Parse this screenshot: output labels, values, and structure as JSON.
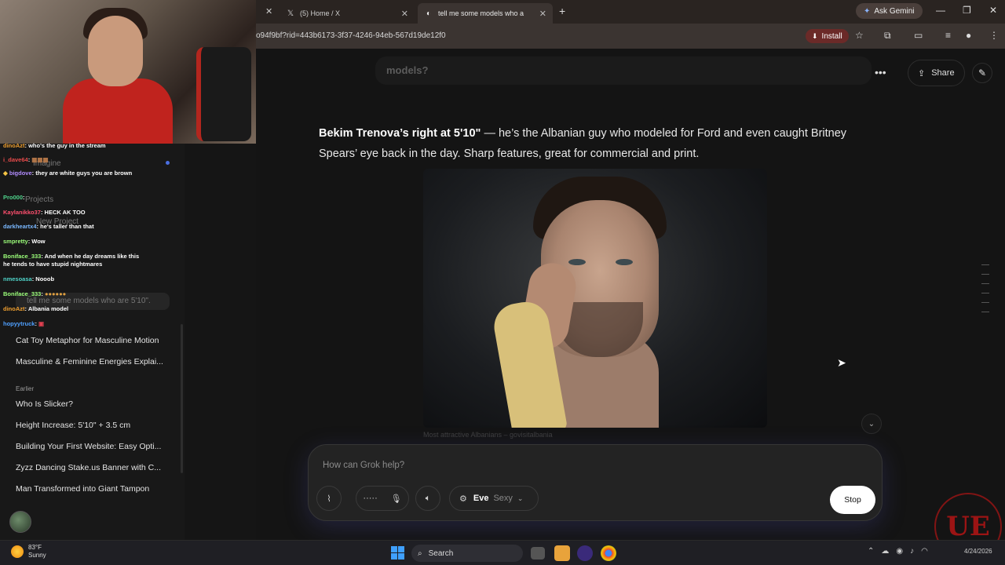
{
  "browser": {
    "tabs": [
      {
        "label": "(5) Home / X",
        "icon": "x-logo-icon"
      },
      {
        "label": "tell me some models who a",
        "icon": "grok-icon"
      }
    ],
    "ask_gemini": "Ask Gemini",
    "url": "o94f9bf?rid=443b6173-3f37-4246-94eb-567d19de12f0",
    "install": "Install"
  },
  "stream_chat": [
    {
      "user": "dinoAzt",
      "color": "#f0a030",
      "text": "who's the guy in the stream"
    },
    {
      "user": "i_dave64",
      "color": "#e94b4b",
      "text": ""
    },
    {
      "user": "bigdove",
      "color": "#b28cff",
      "text": "they are white guys you are brown"
    },
    {
      "user": "Pro000",
      "color": "#4fd38b",
      "text": ""
    },
    {
      "user": "Kaylanikko37",
      "color": "#ff4f6e",
      "text": "HECK AK TOO"
    },
    {
      "user": "darkheartx4",
      "color": "#7ab8ff",
      "text": "he's taller than that"
    },
    {
      "user": "smpretty",
      "color": "#9cff7a",
      "text": "Wow"
    },
    {
      "user": "Boniface_333",
      "color": "#9cff7a",
      "text": "And when he day dreams like this he tends to have stupid nightmares"
    },
    {
      "user": "nmesoasa",
      "color": "#4fd3c8",
      "text": "Nooob"
    },
    {
      "user": "Boniface_333",
      "color": "#9cff7a",
      "text": ""
    },
    {
      "user": "dinoAzt",
      "color": "#f0a030",
      "text": "Albania model"
    },
    {
      "user": "hopyytruck",
      "color": "#4fa0ff",
      "text": ""
    }
  ],
  "sidebar_ghost": {
    "imagine": "Imagine",
    "projects": "Projects",
    "new_project": "New Project",
    "current_chat": "tell me some models who are 5'10\"."
  },
  "sidebar": {
    "items_top": [
      "Cat Toy Metaphor for Masculine Motion",
      "Masculine & Feminine Energies Explai..."
    ],
    "earlier_label": "Earlier",
    "items_earlier": [
      "Who Is Slicker?",
      "Height Increase: 5'10\" + 3.5 cm",
      "Building Your First Website: Easy Opti...",
      "Zyzz Dancing Stake.us Banner with C...",
      "Man Transformed into Giant Tampon"
    ]
  },
  "header": {
    "prev_message": "models?",
    "share": "Share"
  },
  "answer": {
    "bold": "Bekim Trenova’s right at 5'10\"",
    "rest": " — he’s the Albanian guy who modeled for Ford and even caught Britney Spears’ eye back in the day. Sharp features, great for commercial and print."
  },
  "image_caption": "Most attractive Albanians – govisitalbania",
  "composer": {
    "placeholder": "How can Grok help?",
    "persona_name": "Eve",
    "persona_mode": "Sexy",
    "stop": "Stop"
  },
  "taskbar": {
    "temp": "83°F",
    "condition": "Sunny",
    "search": "Search",
    "date": "4/24/2026"
  },
  "watermark": "UE"
}
